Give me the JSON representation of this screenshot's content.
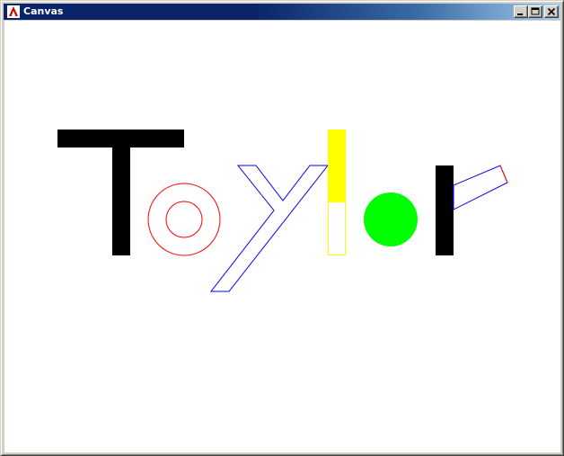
{
  "window": {
    "title": "Canvas",
    "icon": "java-app-icon"
  },
  "titlebar_buttons": [
    {
      "name": "minimize",
      "icon": "minimize-icon"
    },
    {
      "name": "maximize",
      "icon": "maximize-icon"
    },
    {
      "name": "close",
      "icon": "close-icon"
    }
  ],
  "drawing": {
    "letters": [
      "T",
      "o",
      "y",
      "l",
      "o",
      "r"
    ],
    "colors": {
      "black": "#000000",
      "red": "#ff0000",
      "blue": "#0000ff",
      "yellow": "#ffff00",
      "green": "#00ff00",
      "canvas_background": "#ffffff"
    }
  }
}
